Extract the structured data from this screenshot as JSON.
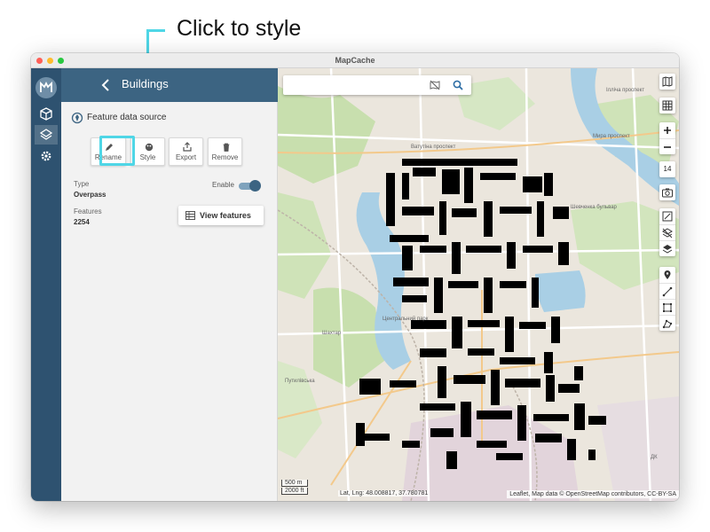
{
  "callout": {
    "text": "Click to style"
  },
  "window": {
    "title": "MapCache"
  },
  "panel": {
    "title": "Buildings",
    "source_label": "Feature data source",
    "actions": [
      {
        "label": "Rename"
      },
      {
        "label": "Style"
      },
      {
        "label": "Export"
      },
      {
        "label": "Remove"
      }
    ],
    "type_label": "Type",
    "type_value": "Overpass",
    "enable_label": "Enable",
    "features_label": "Features",
    "features_value": "2254",
    "view_features_label": "View features"
  },
  "map": {
    "zoom_level": "14",
    "scale_metric": "500 m",
    "scale_imperial": "2000 ft",
    "coords": "Lat, Lng: 48.008817, 37.780781",
    "attribution": "Leaflet, Map data © OpenStreetMap contributors, CC-BY-SA",
    "labels": [
      "Ватутіна проспект",
      "Шевченка бульвар",
      "Мира проспект",
      "Ілліча проспект",
      "Центральний парк",
      "Шахтар",
      "Путилівська",
      "ДК"
    ]
  },
  "colors": {
    "accent": "#4fd6e6",
    "rail": "#2e5270",
    "header": "#3c6482",
    "park": "#c8dfae",
    "water": "#a9cfe5",
    "buildings": "#000000"
  }
}
